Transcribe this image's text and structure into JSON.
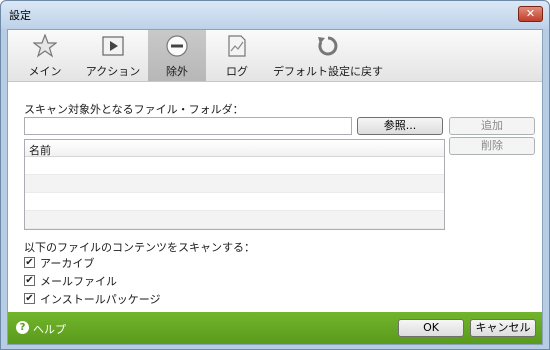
{
  "window": {
    "title": "設定",
    "close_glyph": "✕"
  },
  "toolbar": {
    "items": [
      {
        "label": "メイン",
        "icon": "star-icon"
      },
      {
        "label": "アクション",
        "icon": "play-icon"
      },
      {
        "label": "除外",
        "icon": "minus-circle-icon",
        "active": true
      },
      {
        "label": "ログ",
        "icon": "log-chart-icon"
      },
      {
        "label": "デフォルト設定に戻す",
        "icon": "restore-icon"
      }
    ]
  },
  "exclusion": {
    "section_label": "スキャン対象外となるファイル・フォルダ：",
    "path_value": "",
    "browse_label": "参照...",
    "add_label": "追加",
    "delete_label": "削除",
    "list_header": "名前",
    "rows": [
      "",
      "",
      "",
      ""
    ]
  },
  "content_scan": {
    "section_label": "以下のファイルのコンテンツをスキャンする：",
    "options": [
      {
        "label": "アーカイブ",
        "checked": true
      },
      {
        "label": "メールファイル",
        "checked": true
      },
      {
        "label": "インストールパッケージ",
        "checked": true
      }
    ]
  },
  "footer": {
    "help_label": "ヘルプ",
    "ok_label": "OK",
    "cancel_label": "キャンセル"
  },
  "colors": {
    "footer_green": "#6aab25",
    "active_tab": "#bdbdbd"
  }
}
